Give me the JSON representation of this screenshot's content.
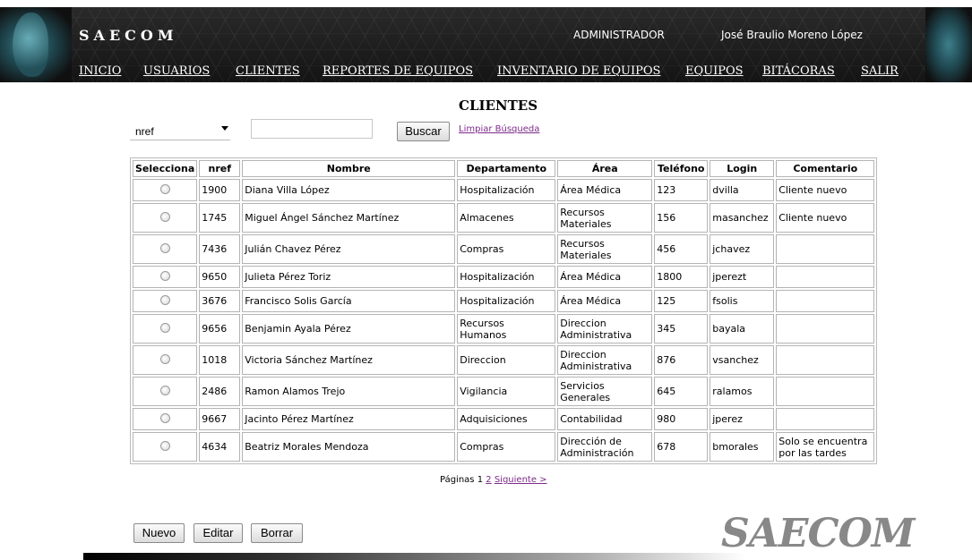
{
  "header": {
    "brand": "SAECOM",
    "role": "ADMINISTRADOR",
    "user": "José Braulio Moreno López"
  },
  "nav": {
    "inicio": "INICIO",
    "usuarios": "USUARIOS",
    "clientes": "CLIENTES",
    "reportes": "REPORTES DE EQUIPOS",
    "inventario": "INVENTARIO DE EQUIPOS",
    "equipos": "EQUIPOS",
    "bitacoras": "BITÁCORAS",
    "salir": "SALIR"
  },
  "page_title": "CLIENTES",
  "search": {
    "field_selected": "nref",
    "value": "",
    "button": "Buscar",
    "clear_link": "Limpiar Búsqueda"
  },
  "table": {
    "headers": [
      "Selecciona",
      "nref",
      "Nombre",
      "Departamento",
      "Área",
      "Teléfono",
      "Login",
      "Comentario"
    ],
    "rows": [
      {
        "nref": "1900",
        "nombre": "Diana Villa López",
        "departamento": "Hospitalización",
        "area": "Área Médica",
        "telefono": "123",
        "login": "dvilla",
        "comentario": "Cliente nuevo"
      },
      {
        "nref": "1745",
        "nombre": "Miguel Ángel Sánchez Martínez",
        "departamento": "Almacenes",
        "area": "Recursos Materiales",
        "telefono": "156",
        "login": "masanchez",
        "comentario": "Cliente nuevo"
      },
      {
        "nref": "7436",
        "nombre": "Julián Chavez Pérez",
        "departamento": "Compras",
        "area": "Recursos Materiales",
        "telefono": "456",
        "login": "jchavez",
        "comentario": ""
      },
      {
        "nref": "9650",
        "nombre": "Julieta Pérez Toriz",
        "departamento": "Hospitalización",
        "area": "Área Médica",
        "telefono": "1800",
        "login": "jperezt",
        "comentario": ""
      },
      {
        "nref": "3676",
        "nombre": "Francisco Solis García",
        "departamento": "Hospitalización",
        "area": "Área Médica",
        "telefono": "125",
        "login": "fsolis",
        "comentario": ""
      },
      {
        "nref": "9656",
        "nombre": "Benjamin Ayala Pérez",
        "departamento": "Recursos Humanos",
        "area": "Direccion Administrativa",
        "telefono": "345",
        "login": "bayala",
        "comentario": ""
      },
      {
        "nref": "1018",
        "nombre": "Victoria Sánchez Martínez",
        "departamento": "Direccion",
        "area": "Direccion Administrativa",
        "telefono": "876",
        "login": "vsanchez",
        "comentario": ""
      },
      {
        "nref": "2486",
        "nombre": "Ramon Alamos Trejo",
        "departamento": "Vigilancia",
        "area": "Servicios Generales",
        "telefono": "645",
        "login": "ralamos",
        "comentario": ""
      },
      {
        "nref": "9667",
        "nombre": "Jacinto Pérez Martínez",
        "departamento": "Adquisiciones",
        "area": "Contabilidad",
        "telefono": "980",
        "login": "jperez",
        "comentario": ""
      },
      {
        "nref": "4634",
        "nombre": "Beatriz Morales Mendoza",
        "departamento": "Compras",
        "area": "Dirección de Administración",
        "telefono": "678",
        "login": "bmorales",
        "comentario": "Solo se encuentra por las tardes"
      }
    ]
  },
  "pager": {
    "label": "Páginas",
    "current": "1",
    "page2": "2",
    "next": "Siguiente >"
  },
  "actions": {
    "nuevo": "Nuevo",
    "editar": "Editar",
    "borrar": "Borrar"
  },
  "footer": {
    "logo_text": "SAECOM"
  }
}
